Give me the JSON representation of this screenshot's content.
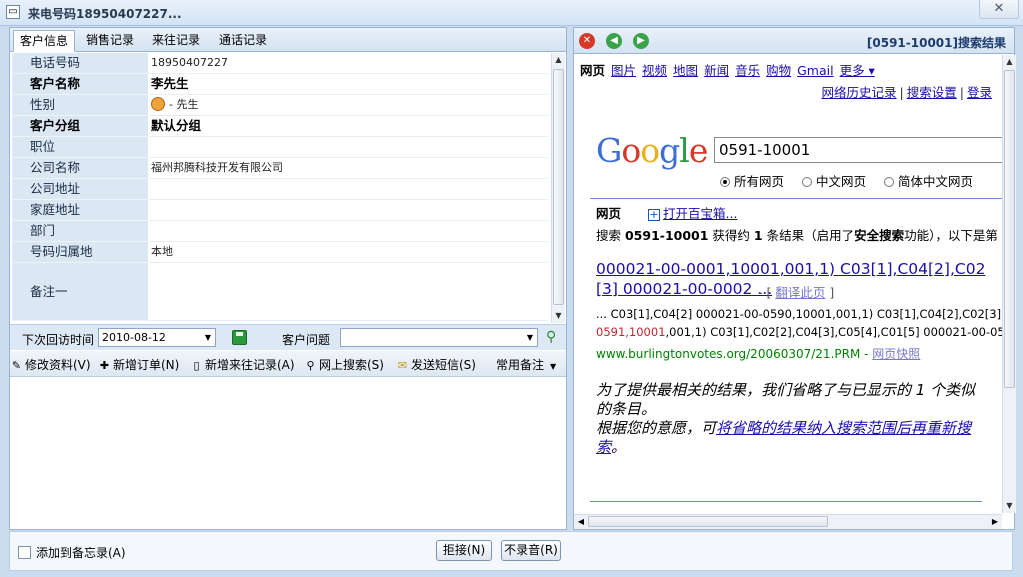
{
  "window": {
    "title": "来电号码18950407227...",
    "close_glyph": "✕"
  },
  "left": {
    "tabs": [
      "客户信息",
      "销售记录",
      "来往记录",
      "通话记录"
    ],
    "fields": [
      {
        "label": "电话号码",
        "value": "18950407227"
      },
      {
        "label": "客户名称",
        "value": "李先生",
        "bold": true
      },
      {
        "label": "性别",
        "value": "- 先生"
      },
      {
        "label": "客户分组",
        "value": "默认分组",
        "bold": true
      },
      {
        "label": "职位",
        "value": ""
      },
      {
        "label": "公司名称",
        "value": "福州邦腾科技开发有限公司"
      },
      {
        "label": "公司地址",
        "value": ""
      },
      {
        "label": "家庭地址",
        "value": ""
      },
      {
        "label": "部门",
        "value": ""
      },
      {
        "label": "号码归属地",
        "value": "本地"
      },
      {
        "label": "备注一",
        "value": ""
      }
    ],
    "followup": {
      "date_label": "下次回访时间",
      "date_value": "2010-08-12",
      "question_label": "客户问题",
      "question_value": ""
    },
    "toolbar": {
      "edit": "修改资料(V)",
      "new_order": "新增订单(N)",
      "new_record": "新增来往记录(A)",
      "web_search": "网上搜索(S)",
      "send_sms": "发送短信(S)",
      "common_notes": "常用备注"
    }
  },
  "bottom": {
    "add_memo": "添加到备忘录(A)",
    "reject": "拒接(N)",
    "no_record": "不录音(R)"
  },
  "right": {
    "title": "[0591-10001]搜索结果",
    "nav": [
      "网页",
      "图片",
      "视频",
      "地图",
      "新闻",
      "音乐",
      "购物",
      "Gmail",
      "更多 ▾"
    ],
    "account": [
      "网络历史记录",
      "搜索设置",
      "登录"
    ],
    "logo": "Google",
    "query": "0591-10001",
    "radios": [
      "所有网页",
      "中文网页",
      "简体中文网页"
    ],
    "section": "网页",
    "toolbox": "打开百宝箱...",
    "stats_prefix": "搜索 ",
    "stats_query": "0591-10001",
    "stats_mid": " 获得约 ",
    "stats_count": "1",
    "stats_mid2": " 条结果（启用了",
    "stats_safe": "安全搜索",
    "stats_suffix": "功能），以下是第",
    "result": {
      "title_line1": "000021-00-0001,10001,001,1) C03[1],C04[2],C02",
      "title_line2": "[3] 000021-00-0002 ...",
      "translate_prefix": " - [ ",
      "translate": "翻译此页",
      "translate_suffix": " ]",
      "snippet1": "... C03[1],C04[2] 000021-00-0590,10001,001,1) C03[1],C04[2],C02[3]",
      "snippet2_hl": "0591,10001",
      "snippet2_rest": ",001,1) C03[1],C02[2],C04[3],C05[4],C01[5] 000021-00-05",
      "url": "www.burlingtonvotes.org/20060307/21.PRM",
      "url_sep": " - ",
      "cache": "网页快照"
    },
    "omitted_line1": "为了提供最相关的结果，我们省略了与已显示的 1 个类似的条目。",
    "omitted_line2_prefix": "根据您的意愿，可",
    "omitted_link": "将省略的结果纳入搜索范围后再重新搜索",
    "omitted_line2_suffix": "。"
  },
  "colors": {
    "accent": "#1a0dab",
    "panel_label_bg": "#dce7f4",
    "url_green": "#008000",
    "highlight_red": "#c0272d"
  }
}
